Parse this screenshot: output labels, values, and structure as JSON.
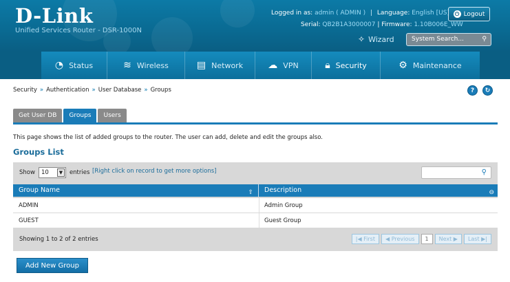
{
  "brand": {
    "logo": "D-Link",
    "subtitle": "Unified Services Router - DSR-1000N"
  },
  "header": {
    "logged_in_label": "Logged in as:",
    "logged_in_value": "admin ( ADMIN )",
    "language_label": "Language:",
    "language_value": "English [US]",
    "serial_label": "Serial:",
    "serial_value": "QB2B1A3000007",
    "firmware_label": "Firmware:",
    "firmware_value": "1.10B006E_WW",
    "logout_label": "Logout",
    "wizard_label": "Wizard",
    "search_placeholder": "System Search..."
  },
  "nav": {
    "items": [
      {
        "label": "Status",
        "icon": "dashboard-icon"
      },
      {
        "label": "Wireless",
        "icon": "wifi-icon"
      },
      {
        "label": "Network",
        "icon": "monitor-icon"
      },
      {
        "label": "VPN",
        "icon": "cloud-lock-icon"
      },
      {
        "label": "Security",
        "icon": "lock-icon"
      },
      {
        "label": "Maintenance",
        "icon": "gear-icon"
      }
    ],
    "active": "Security"
  },
  "breadcrumb": [
    "Security",
    "Authentication",
    "User Database",
    "Groups"
  ],
  "breadcrumb_sep": "»",
  "tabs": [
    {
      "label": "Get User DB"
    },
    {
      "label": "Groups"
    },
    {
      "label": "Users"
    }
  ],
  "description": "This page shows the list of added groups to the router. The user can add, delete and edit the groups also.",
  "list_title": "Groups List",
  "grid": {
    "show_label": "Show",
    "entries_value": "10",
    "entries_label": "entries",
    "hint": "[Right click on record to get more options]",
    "columns": [
      "Group Name",
      "Description"
    ],
    "rows": [
      {
        "name": "ADMIN",
        "description": "Admin Group"
      },
      {
        "name": "GUEST",
        "description": "Guest Group"
      }
    ],
    "footer_info": "Showing 1 to 2 of 2 entries",
    "pager": {
      "first": "First",
      "previous": "Previous",
      "current": "1",
      "next": "Next",
      "last": "Last"
    }
  },
  "add_button": "Add New Group",
  "colors": {
    "header_blue": "#0a6a92",
    "accent_blue": "#1a7cb8",
    "tab_inactive": "#8a8a8a",
    "grid_bg": "#d8d8d8"
  }
}
